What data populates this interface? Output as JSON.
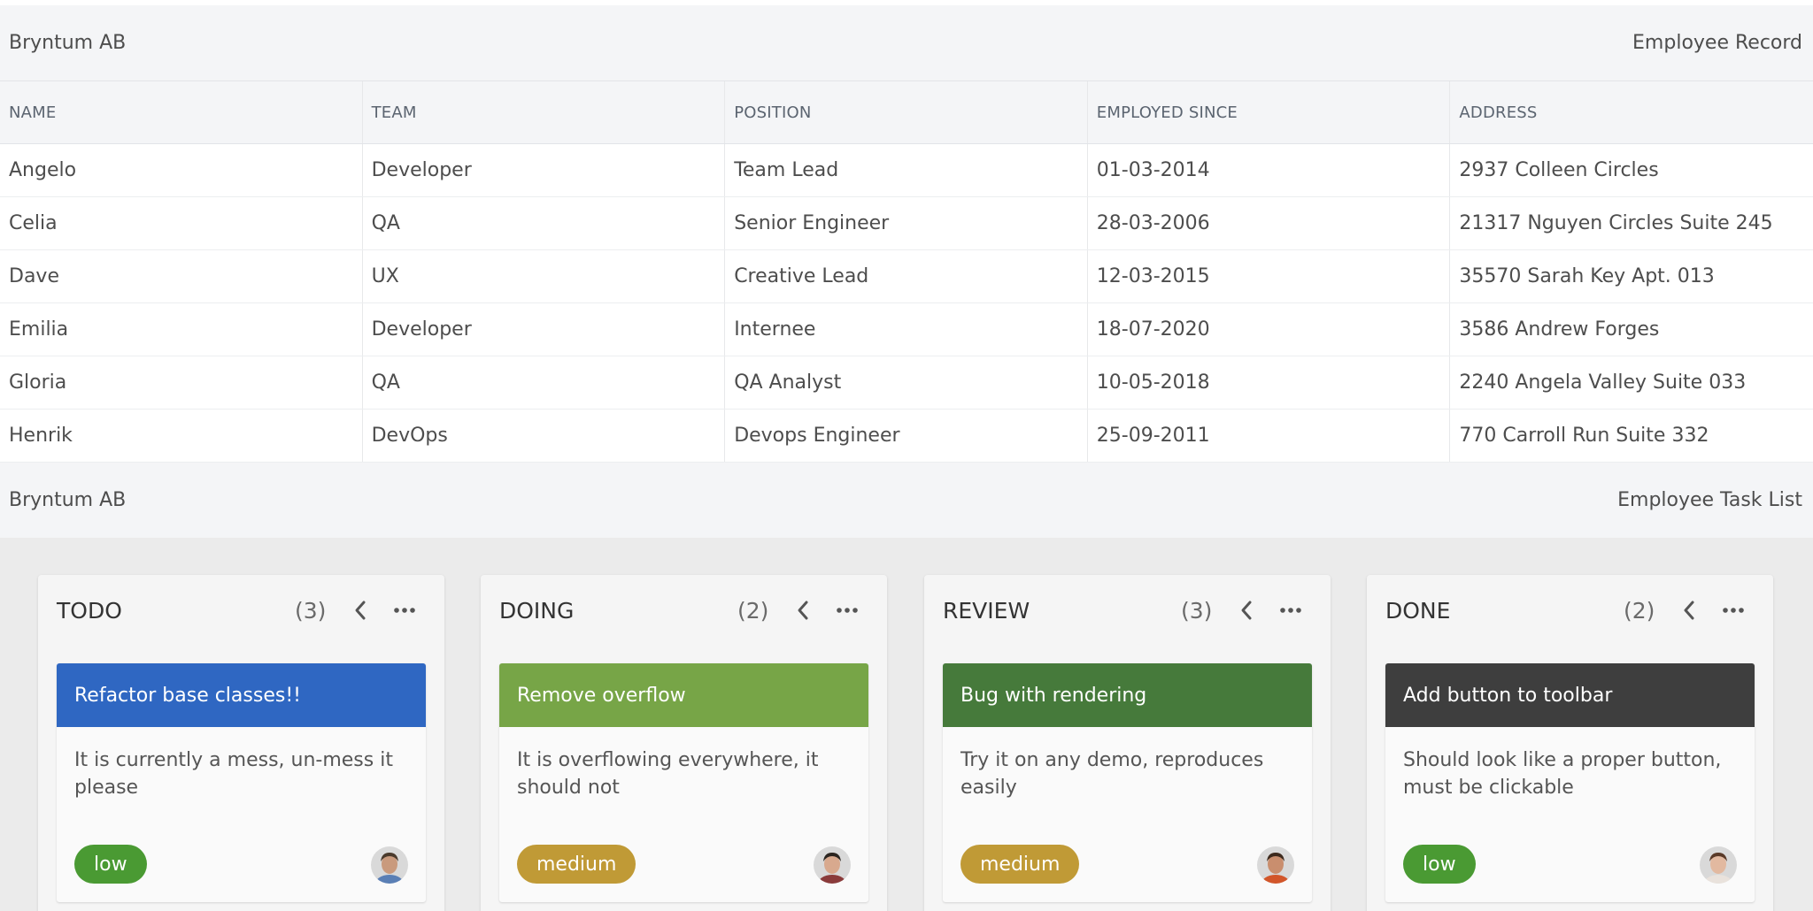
{
  "record_header": {
    "company": "Bryntum AB",
    "title": "Employee Record"
  },
  "grid": {
    "columns": [
      "NAME",
      "TEAM",
      "POSITION",
      "EMPLOYED SINCE",
      "ADDRESS"
    ],
    "rows": [
      [
        "Angelo",
        "Developer",
        "Team Lead",
        "01-03-2014",
        "2937 Colleen Circles"
      ],
      [
        "Celia",
        "QA",
        "Senior Engineer",
        "28-03-2006",
        "21317 Nguyen Circles Suite 245"
      ],
      [
        "Dave",
        "UX",
        "Creative Lead",
        "12-03-2015",
        "35570 Sarah Key Apt. 013"
      ],
      [
        "Emilia",
        "Developer",
        "Internee",
        "18-07-2020",
        "3586 Andrew Forges"
      ],
      [
        "Gloria",
        "QA",
        "QA Analyst",
        "10-05-2018",
        "2240 Angela Valley Suite 033"
      ],
      [
        "Henrik",
        "DevOps",
        "Devops Engineer",
        "25-09-2011",
        "770 Carroll Run Suite 332"
      ]
    ]
  },
  "task_header": {
    "company": "Bryntum AB",
    "title": "Employee Task List"
  },
  "board": {
    "columns": [
      {
        "title": "TODO",
        "count": "(3)",
        "card": {
          "title": "Refactor base classes!!",
          "color": "#2f67c2",
          "body": "It is currently a mess, un-mess it please",
          "tag": "low",
          "tag_color": "#4a9a33",
          "avatar_skin": "#c99a7d",
          "avatar_hair": "#4a3a2c",
          "avatar_shirt": "#5a7fb5"
        }
      },
      {
        "title": "DOING",
        "count": "(2)",
        "card": {
          "title": "Remove overflow",
          "color": "#77a547",
          "body": "It is overflowing everywhere, it should not",
          "tag": "medium",
          "tag_color": "#c09a36",
          "avatar_skin": "#d8a98e",
          "avatar_hair": "#2b2520",
          "avatar_shirt": "#8a3b3b"
        }
      },
      {
        "title": "REVIEW",
        "count": "(3)",
        "card": {
          "title": "Bug with rendering",
          "color": "#467a3b",
          "body": "Try it on any demo, reproduces easily",
          "tag": "medium",
          "tag_color": "#c09a36",
          "avatar_skin": "#c98e6e",
          "avatar_hair": "#3d2a1e",
          "avatar_shirt": "#d2562a"
        }
      },
      {
        "title": "DONE",
        "count": "(2)",
        "card": {
          "title": "Add button to toolbar",
          "color": "#3e3e3e",
          "body": "Should look like a proper button, must be clickable",
          "tag": "low",
          "tag_color": "#4a9a33",
          "avatar_skin": "#e2b9a0",
          "avatar_hair": "#5a3a28",
          "avatar_shirt": "#e9e2dc"
        }
      }
    ],
    "icons": {
      "collapse": "chevron-left-icon",
      "menu": "ellipsis-icon"
    }
  }
}
